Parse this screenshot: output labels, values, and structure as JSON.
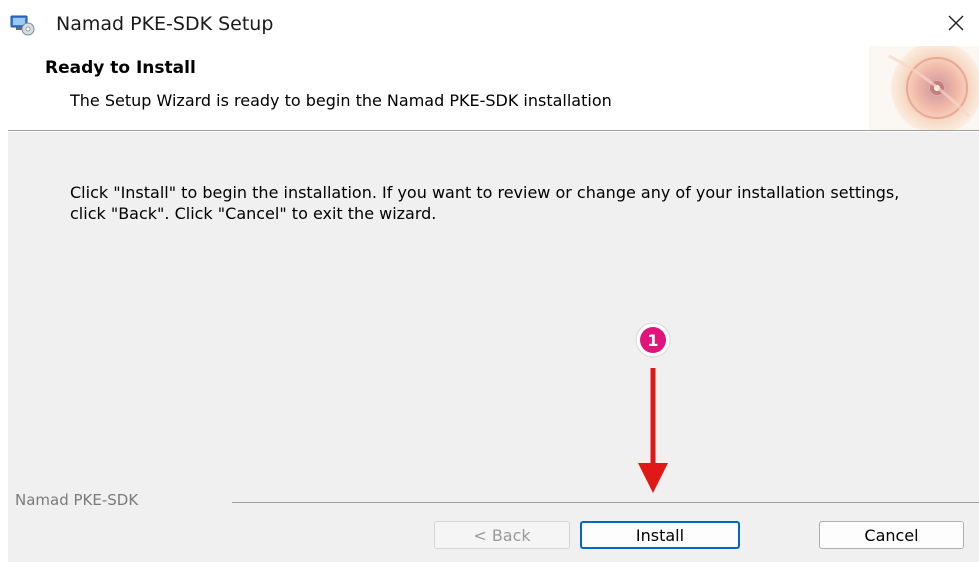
{
  "window": {
    "title": "Namad PKE-SDK Setup",
    "close_icon": "close-icon"
  },
  "header": {
    "title": "Ready to Install",
    "description": "The Setup Wizard is ready to begin the Namad PKE-SDK installation"
  },
  "body": {
    "message": "Click \"Install\" to begin the installation.  If you want to review or change any of your installation settings, click \"Back\".  Click \"Cancel\" to exit the wizard."
  },
  "footer": {
    "brand": "Namad PKE-SDK",
    "back_label": "< Back",
    "install_label": "Install",
    "cancel_label": "Cancel"
  },
  "annotation": {
    "step_number": "1",
    "color": "#e0147a",
    "arrow_color": "#e01818"
  },
  "colors": {
    "accent": "#0067c0",
    "body_bg": "#f0f0f0"
  }
}
